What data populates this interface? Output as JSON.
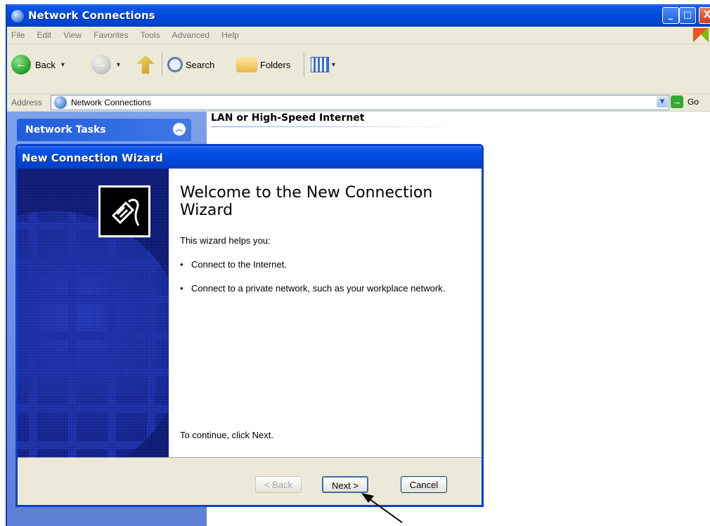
{
  "window": {
    "title": "Network Connections",
    "controls": {
      "minimize": "_",
      "maximize": "□",
      "close": "X"
    }
  },
  "menubar": {
    "items": [
      "File",
      "Edit",
      "View",
      "Favorites",
      "Tools",
      "Advanced",
      "Help"
    ]
  },
  "toolbar": {
    "back_label": "Back",
    "search_label": "Search",
    "folders_label": "Folders"
  },
  "addressbar": {
    "label": "Address",
    "value": "Network Connections",
    "go_label": "Go"
  },
  "taskpane": {
    "header": "Network Tasks"
  },
  "content": {
    "heading": "LAN or High-Speed Internet"
  },
  "wizard": {
    "title": "New Connection Wizard",
    "heading": "Welcome to the New Connection Wizard",
    "intro": "This wizard helps you:",
    "bullets": [
      "Connect to the Internet.",
      "Connect to a private network, such as your workplace network."
    ],
    "footer": "To continue, click Next.",
    "buttons": {
      "back": "< Back",
      "next": "Next >",
      "cancel": "Cancel"
    }
  },
  "colors": {
    "titlebar": "#0049dd",
    "sidebar_dark": "#0d1a76",
    "taskpane": "#6f90df"
  }
}
